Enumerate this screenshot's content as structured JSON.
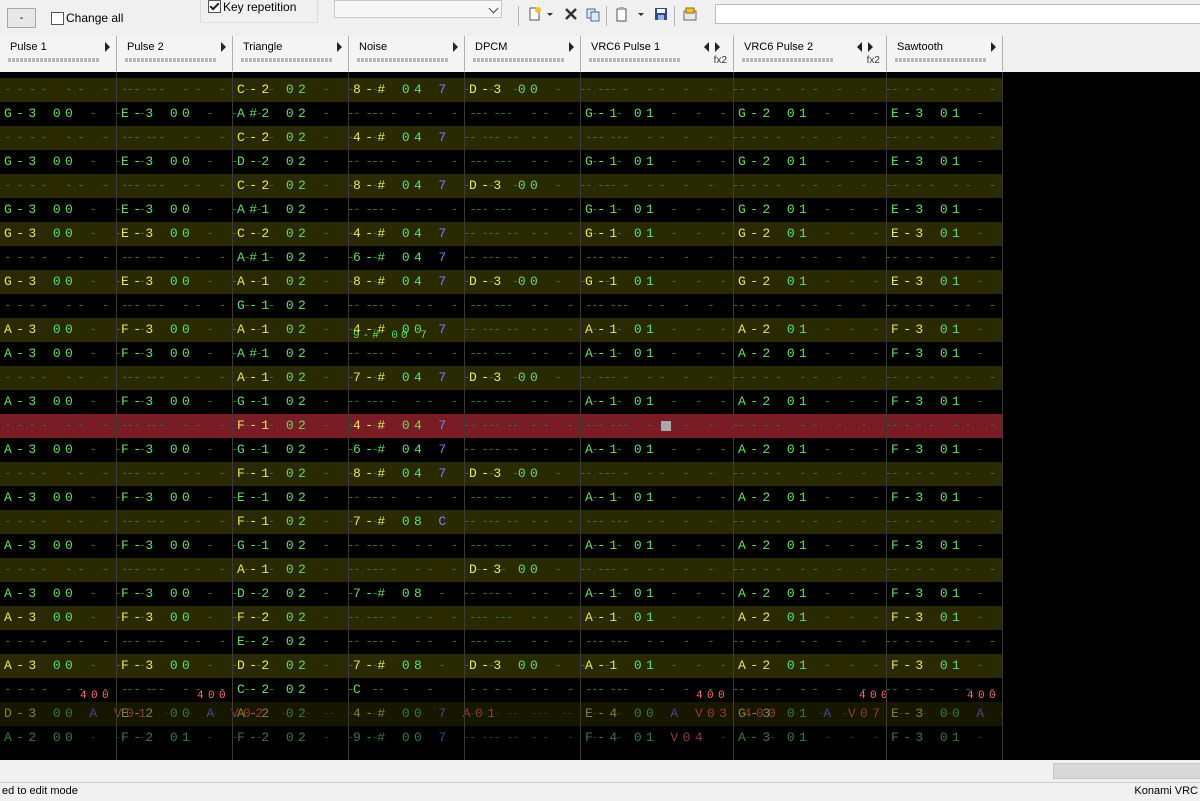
{
  "toolbar": {
    "minus_label": "-",
    "change_all_label": "Change all",
    "change_all_checked": false,
    "key_repetition_label": "Key repetition",
    "key_repetition_checked": true,
    "combo_value": "",
    "search_value": "",
    "icons": [
      "new-icon",
      "dropdown-arrow-icon",
      "delete-icon",
      "copy-icon",
      "paste-icon",
      "dropdown-arrow-icon",
      "save-icon",
      "properties-icon"
    ]
  },
  "channels": [
    {
      "name": "Pulse 1",
      "nav": "right",
      "fx": ""
    },
    {
      "name": "Pulse 2",
      "nav": "right",
      "fx": ""
    },
    {
      "name": "Triangle",
      "nav": "right",
      "fx": ""
    },
    {
      "name": "Noise",
      "nav": "right",
      "fx": ""
    },
    {
      "name": "DPCM",
      "nav": "right",
      "fx": ""
    },
    {
      "name": "VRC6 Pulse 1",
      "nav": "both",
      "fx": "fx2"
    },
    {
      "name": "VRC6 Pulse 2",
      "nav": "both",
      "fx": "fx2"
    },
    {
      "name": "Sawtooth",
      "nav": "right",
      "fx": ""
    }
  ],
  "pattern_rows": [
    {
      "hl": true,
      "cells": [
        "---- --",
        "---- --",
        "C-2 02",
        "8-# 04 7",
        "D-3 00",
        "---- --",
        "---- --",
        "---- --"
      ]
    },
    {
      "hl": false,
      "cells": [
        "G-3 00",
        "E-3 00",
        "A#2 02",
        "",
        "",
        "G-1 01",
        "G-2 01",
        "E-3 01"
      ]
    },
    {
      "hl": true,
      "cells": [
        "---- --",
        "---- --",
        "C-2 02",
        "4-# 04 7",
        "",
        "---- --",
        "---- --",
        "---- --"
      ]
    },
    {
      "hl": false,
      "cells": [
        "G-3 00",
        "E-3 00",
        "D-2 02",
        "",
        "",
        "G-1 01",
        "G-2 01",
        "E-3 01"
      ]
    },
    {
      "hl": true,
      "cells": [
        "---- --",
        "---- --",
        "C-2 02",
        "8-# 04 7",
        "D-3 00",
        "---- --",
        "---- --",
        "---- --"
      ]
    },
    {
      "hl": false,
      "cells": [
        "G-3 00",
        "E-3 00",
        "A#1 02",
        "",
        "",
        "G-1 01",
        "G-2 01",
        "E-3 01"
      ]
    },
    {
      "hl": true,
      "cells": [
        "G-3 00",
        "E-3 00",
        "C-2 02",
        "4-# 04 7",
        "",
        "G-1 01",
        "G-2 01",
        "E-3 01"
      ]
    },
    {
      "hl": false,
      "cells": [
        "",
        "",
        "A#1 02",
        "6-# 04 7",
        "",
        "",
        "",
        ""
      ]
    },
    {
      "hl": true,
      "cells": [
        "G-3 00",
        "E-3 00",
        "A-1 02",
        "8-# 04 7",
        "D-3 00",
        "G-1 01",
        "G-2 01",
        "E-3 01"
      ]
    },
    {
      "hl": false,
      "cells": [
        "",
        "",
        "G-1 02",
        "",
        "",
        "",
        "",
        ""
      ]
    },
    {
      "hl": true,
      "cells": [
        "A-3 00",
        "F-3 00",
        "A-1 02",
        "4-# 00 7",
        "",
        "A-1 01",
        "A-2 01",
        "F-3 01"
      ]
    },
    {
      "hl": false,
      "cells": [
        "A-3 00",
        "F-3 00",
        "A#1 02",
        "",
        "",
        "A-1 01",
        "A-2 01",
        "F-3 01"
      ]
    },
    {
      "hl": true,
      "cells": [
        "---- --",
        "---- --",
        "A-1 02",
        "7-# 04 7",
        "D-3 00",
        "---- --",
        "---- --",
        "---- --"
      ]
    },
    {
      "hl": false,
      "cells": [
        "A-3 00",
        "F-3 00",
        "G-1 02",
        "",
        "",
        "A-1 01",
        "A-2 01",
        "F-3 01"
      ]
    },
    {
      "hl": true,
      "cur": true,
      "cells": [
        "---- --",
        "---- --",
        "F-1 02",
        "4-# 04 7",
        "",
        "---- --",
        "---- --",
        "---- --"
      ]
    },
    {
      "hl": false,
      "cells": [
        "A-3 00",
        "F-3 00",
        "G-1 02",
        "6-# 04 7",
        "",
        "A-1 01",
        "A-2 01",
        "F-3 01"
      ]
    },
    {
      "hl": true,
      "cells": [
        "---- --",
        "---- --",
        "F-1 02",
        "8-# 04 7",
        "D-3 00",
        "---- --",
        "---- --",
        "---- --"
      ]
    },
    {
      "hl": false,
      "cells": [
        "A-3 00",
        "F-3 00",
        "E-1 02",
        "",
        "",
        "A-1 01",
        "A-2 01",
        "F-3 01"
      ]
    },
    {
      "hl": true,
      "cells": [
        "---- --",
        "---- --",
        "F-1 02",
        "7-# 08 C",
        "",
        "---- --",
        "---- --",
        "---- --"
      ]
    },
    {
      "hl": false,
      "cells": [
        "A-3 00",
        "F-3 00",
        "G-1 02",
        "",
        "",
        "A-1 01",
        "A-2 01",
        "F-3 01"
      ]
    },
    {
      "hl": true,
      "cells": [
        "---- --",
        "---- --",
        "A-1 02",
        "",
        "D-3 00",
        "---- --",
        "---- --",
        "---- --"
      ]
    },
    {
      "hl": false,
      "cells": [
        "A-3 00",
        "F-3 00",
        "D-2 02",
        "7-# 08",
        "",
        "A-1 01",
        "A-2 01",
        "F-3 01"
      ]
    },
    {
      "hl": true,
      "cells": [
        "A-3 00",
        "F-3 00",
        "F-2 02",
        "",
        "",
        "A-1 01",
        "A-2 01",
        "F-3 01"
      ]
    },
    {
      "hl": false,
      "cells": [
        "",
        "",
        "E-2 02",
        "",
        "",
        "",
        "",
        ""
      ]
    },
    {
      "hl": true,
      "cells": [
        "A-3 00",
        "F-3 00",
        "D-2 02",
        "7-# 08",
        "D-3 00",
        "A-1 01",
        "A-2 01",
        "F-3 01"
      ]
    },
    {
      "hl": false,
      "cells": [
        "",
        "",
        "C-2 02",
        "C",
        "",
        "",
        "",
        ""
      ]
    },
    {
      "hl": true,
      "faded": true,
      "cells": [
        "D-3 00 A V01",
        "E-2 00 A V02",
        "A-2 02",
        "4-# 00 7 A01",
        "",
        "E-4 00 A V03 400",
        "G-3 01 A V07",
        "E-3 00 A 400"
      ]
    },
    {
      "hl": false,
      "faded": true,
      "cells": [
        "A-2 00",
        "F-2 01",
        "F-2 02",
        "9-# 00 7",
        "",
        "F-4 01 V04",
        "A-3 01",
        "F-3 01"
      ]
    }
  ],
  "sub_notes": {
    "noise_row10": "9-# 00 7",
    "row26_sub": [
      "",
      "F-2 01",
      "",
      "9-# 00 7",
      "",
      "F-4 01 V04",
      "A-3 01",
      "F-3 01"
    ],
    "fx_values": [
      "400",
      "400",
      "400",
      "400"
    ]
  },
  "status": {
    "left_text": "ed to edit mode",
    "right_text": "Konami VRC"
  }
}
